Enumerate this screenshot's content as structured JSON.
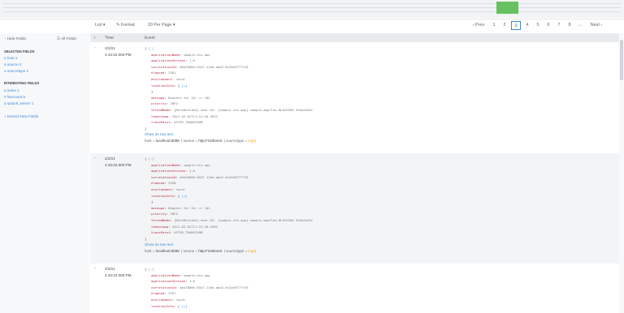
{
  "toolbar": {
    "list": "List ▾",
    "format": "✎ Format",
    "per_page": "20 Per Page ▾",
    "prev": "‹ Prev",
    "pages": [
      "1",
      "2",
      "3",
      "4",
      "5",
      "6",
      "7",
      "8",
      "..."
    ],
    "active_page": "3",
    "next": "Next ›"
  },
  "sidebar": {
    "hide_fields": "‹ Hide Fields",
    "all_fields": "☰ All Fields",
    "selected_title": "SELECTED FIELDS",
    "selected": [
      "a host 1",
      "a source 2",
      "a sourcetype 1"
    ],
    "interesting_title": "INTERESTING FIELDS",
    "interesting": [
      "a index 1",
      "# linecount 5",
      "a splunk_server 1"
    ],
    "extract": "+ Extract New Fields"
  },
  "table": {
    "col_info": "i",
    "col_time": "Time",
    "col_event": "Event"
  },
  "events": [
    {
      "date": "2/2/21",
      "time": "4:43:22.000 PM",
      "collapse": "[-]",
      "applicationName": "sample-elk-app",
      "applicationVersion": "1.0",
      "correlationId": "a6a78060-6547-11eb-aba2-6c2b59777f19",
      "elapsed": "2361",
      "environment": "local",
      "locationInfo": "[+]",
      "message": "Request for Id: => 102",
      "priority": "INFO",
      "threadName": "[MuleRuntime].uber.02: [sample-elk-app].sample-appflow.BLOCKING 945a2a45f",
      "timestamp": "2021-02-02T11:13:20.381Z",
      "tracePoint": "AFTER_TRANSFORM",
      "show_raw": "Show as raw text",
      "host_label": "host = ",
      "host": "localhost:8088",
      "source_label": "source = ",
      "source": "http:FirstEvent",
      "sourcetype_label": "sourcetype = ",
      "sourcetype": "log4j"
    },
    {
      "date": "2/2/21",
      "time": "4:43:22.000 PM",
      "collapse": "[-]",
      "applicationName": "sample-elk-app",
      "applicationVersion": "1.0",
      "correlationId": "a6a78060-6547-11eb-aba2-6c2b59777f19",
      "elapsed": "2358",
      "environment": "local",
      "locationInfo": "[+]",
      "message": "Request for Id: => 102",
      "priority": "INFO",
      "threadName": "[MuleRuntime].uber.02: [sample-elk-app].sample-appflow.BLOCKING 945a2a45f",
      "timestamp": "2021-02-02T11:13:20.358Z",
      "tracePoint": "AFTER_TRANSFORM",
      "show_raw": "Show as raw text",
      "host_label": "host = ",
      "host": "localhost:8088",
      "source_label": "source = ",
      "source": "http:FirstEvent",
      "sourcetype_label": "sourcetype = ",
      "sourcetype": "log4j"
    },
    {
      "date": "2/2/21",
      "time": "4:43:22.000 PM",
      "collapse": "[-]",
      "applicationName": "sample-elk-app",
      "applicationVersion": "1.0",
      "correlationId": "a6a78060-6547-11eb-aba2-6c2b59777f19",
      "elapsed": "2357",
      "environment": "local",
      "locationInfo": "[+]"
    }
  ]
}
